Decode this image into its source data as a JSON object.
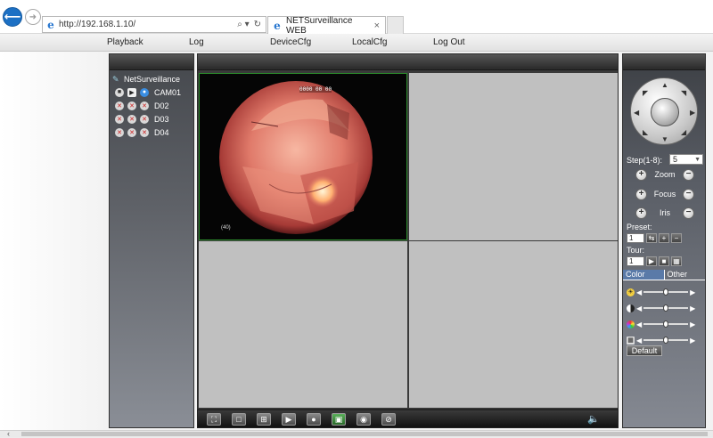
{
  "browser": {
    "url": "http://192.168.1.10/",
    "tab_title": "NETSurveillance WEB",
    "tab_close": "×",
    "address_search_icon": "search-icon",
    "address_refresh_icon": "refresh-icon"
  },
  "menu": {
    "items": [
      "Playback",
      "Log",
      "DeviceCfg",
      "LocalCfg",
      "Log Out"
    ]
  },
  "device_tree": {
    "root": "NetSurveillance",
    "channels": [
      {
        "label": "CAM01",
        "status": "connected"
      },
      {
        "label": "D02",
        "status": "disconnected"
      },
      {
        "label": "D03",
        "status": "disconnected"
      },
      {
        "label": "D04",
        "status": "disconnected"
      }
    ]
  },
  "video": {
    "overlay_text": "0000 00 00",
    "cam_tag": "(40)",
    "toolbar_icons": [
      "fullscreen-icon",
      "single-view-icon",
      "quad-view-icon",
      "play-all-icon",
      "stop-all-icon",
      "snapshot-icon",
      "record-icon",
      "stop-record-icon"
    ],
    "volume_icon": "volume-mute-icon"
  },
  "ptz": {
    "step_label": "Step(1-8):",
    "step_value": "5",
    "zoom_label": "Zoom",
    "focus_label": "Focus",
    "iris_label": "Iris",
    "preset_label": "Preset:",
    "preset_value": "1",
    "tour_label": "Tour:",
    "tour_value": "1"
  },
  "color": {
    "tabs": [
      "Color",
      "Other"
    ],
    "sliders": [
      {
        "name": "brightness",
        "value": 0.5
      },
      {
        "name": "contrast",
        "value": 0.5
      },
      {
        "name": "saturation",
        "value": 0.5
      },
      {
        "name": "hue",
        "value": 0.5
      }
    ],
    "default_label": "Default"
  },
  "colors": {
    "accent": "#1c70c4",
    "active_cell_border": "#2a8a2a",
    "panel_dark": "#3c3f44"
  }
}
